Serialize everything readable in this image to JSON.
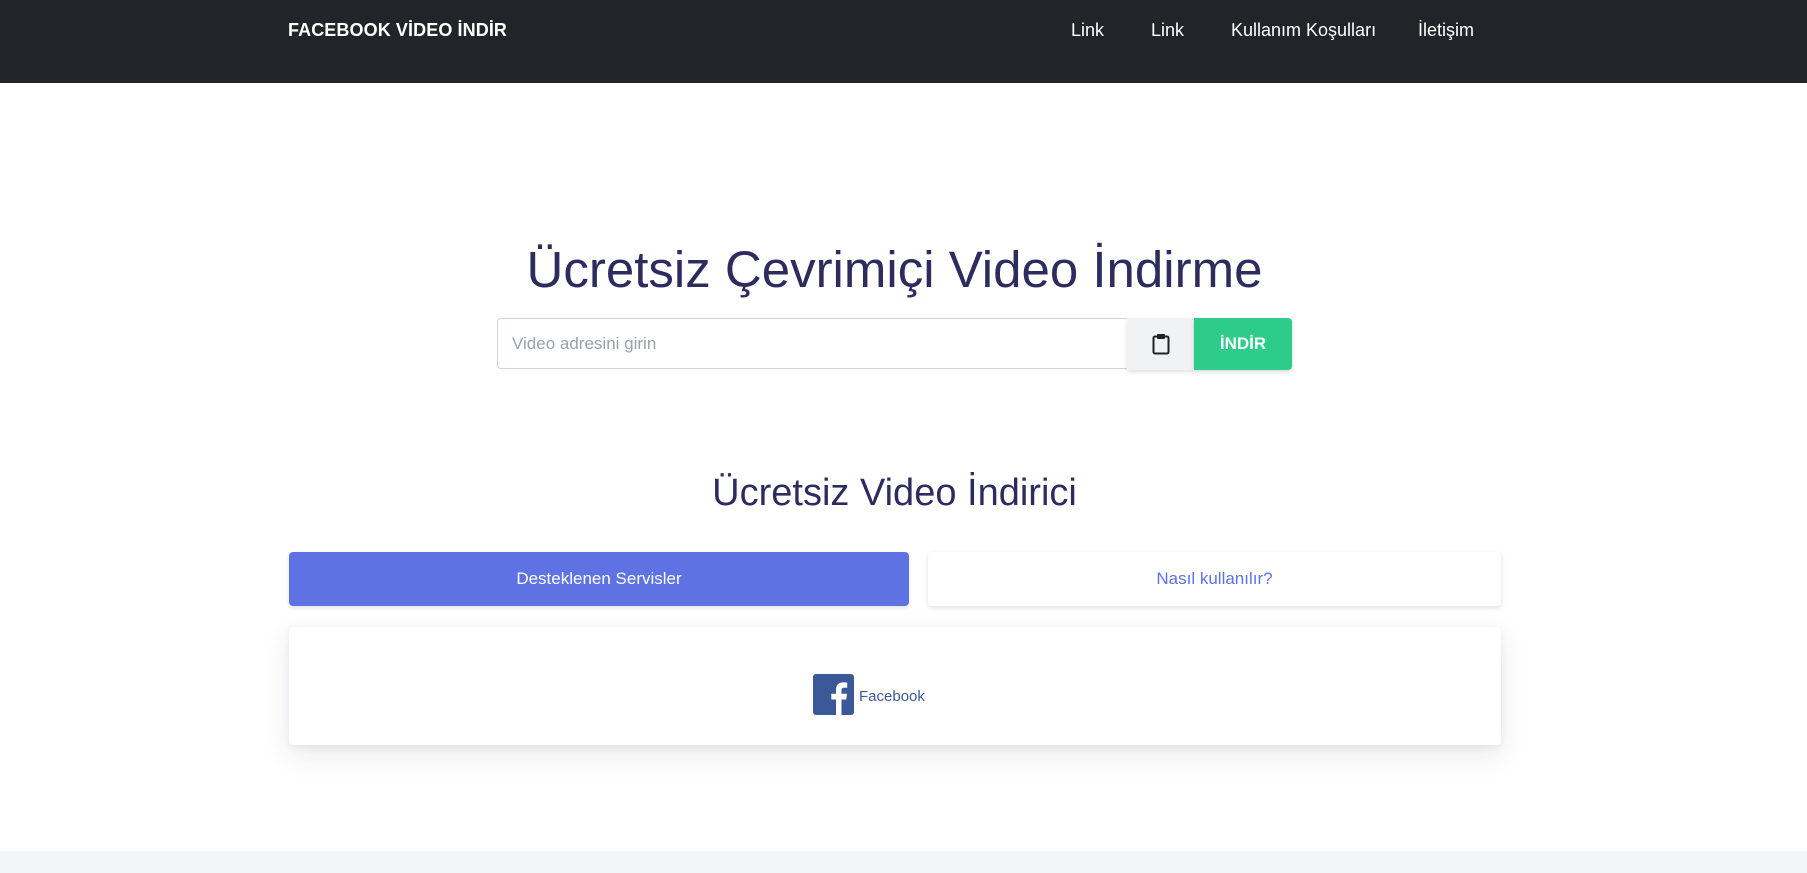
{
  "navbar": {
    "brand": "FACEBOOK VİDEO İNDİR",
    "links": [
      "Link",
      "Link",
      "Kullanım Koşulları",
      "İletişim"
    ],
    "background": "#212529"
  },
  "hero": {
    "title": "Ücretsiz Çevrimiçi Video İndirme",
    "search": {
      "placeholder": "Video adresini girin",
      "value": ""
    },
    "paste_icon": "clipboard-icon",
    "download_label": "İNDİR",
    "download_color": "#2ecc8a"
  },
  "section": {
    "title": "Ücretsiz Video İndirici",
    "tabs": [
      {
        "label": "Desteklenen Servisler",
        "active": true
      },
      {
        "label": "Nasıl kullanılır?",
        "active": false
      }
    ],
    "accent": "#5e72e4",
    "services": [
      {
        "label": "Facebook",
        "icon": "facebook-icon",
        "color": "#3b5998"
      }
    ]
  }
}
